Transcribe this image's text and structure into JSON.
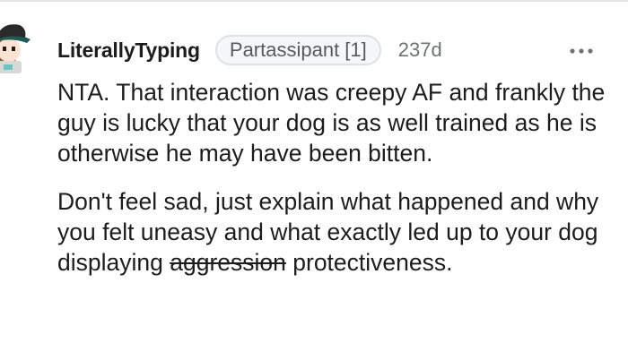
{
  "comment": {
    "username": "LiterallyTyping",
    "flair": "Partassipant [1]",
    "age": "237d",
    "paragraph1": "NTA. That interaction was creepy AF and frankly the guy is lucky that your dog is as well trained as he is otherwise he may have been bitten.",
    "paragraph2_before": "Don't feel sad, just explain what happened and why you felt uneasy and what exactly led up to your dog displaying",
    "paragraph2_struck": "aggression",
    "paragraph2_after": "protectiveness."
  },
  "icons": {
    "avatar": "snoo-avatar-icon",
    "more": "more-options-icon"
  },
  "colors": {
    "text": "#1c1c1c",
    "meta": "#6f7173",
    "flair_bg": "#f6f7f8",
    "flair_border": "#dfe1e3",
    "avatar_hat": "#1f5a54"
  }
}
